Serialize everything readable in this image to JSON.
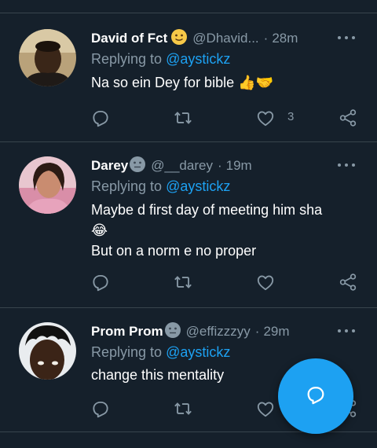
{
  "colors": {
    "background": "#15202b",
    "accent": "#1da1f2",
    "muted": "#8899a6",
    "divider": "#38444d"
  },
  "replying_label": "Replying to",
  "tweets": [
    {
      "name": "David of Fct",
      "name_emoji": "slightly-smiling-face",
      "handle": "@Dhavid...",
      "dot": "·",
      "time": "28m",
      "mention": "@aystickz",
      "lines": [
        "Na so ein Dey for bible 👍🤝"
      ],
      "like_count": "3"
    },
    {
      "name": "Darey",
      "name_emoji": "neutral-face",
      "handle": "@__darey",
      "dot": "·",
      "time": "19m",
      "mention": "@aystickz",
      "lines": [
        "Maybe d first day of meeting him sha",
        "😂",
        "But on a norm e no proper"
      ],
      "like_count": ""
    },
    {
      "name": "Prom Prom",
      "name_emoji": "neutral-face",
      "handle": "@effizzzyy",
      "dot": "·",
      "time": "29m",
      "mention": "@aystickz",
      "lines": [
        "change this mentality"
      ],
      "like_count": ""
    }
  ],
  "icons": {
    "reply": "reply-icon",
    "retweet": "retweet-icon",
    "like": "heart-icon",
    "share": "share-icon",
    "more": "more-icon",
    "compose": "compose-reply-icon"
  }
}
